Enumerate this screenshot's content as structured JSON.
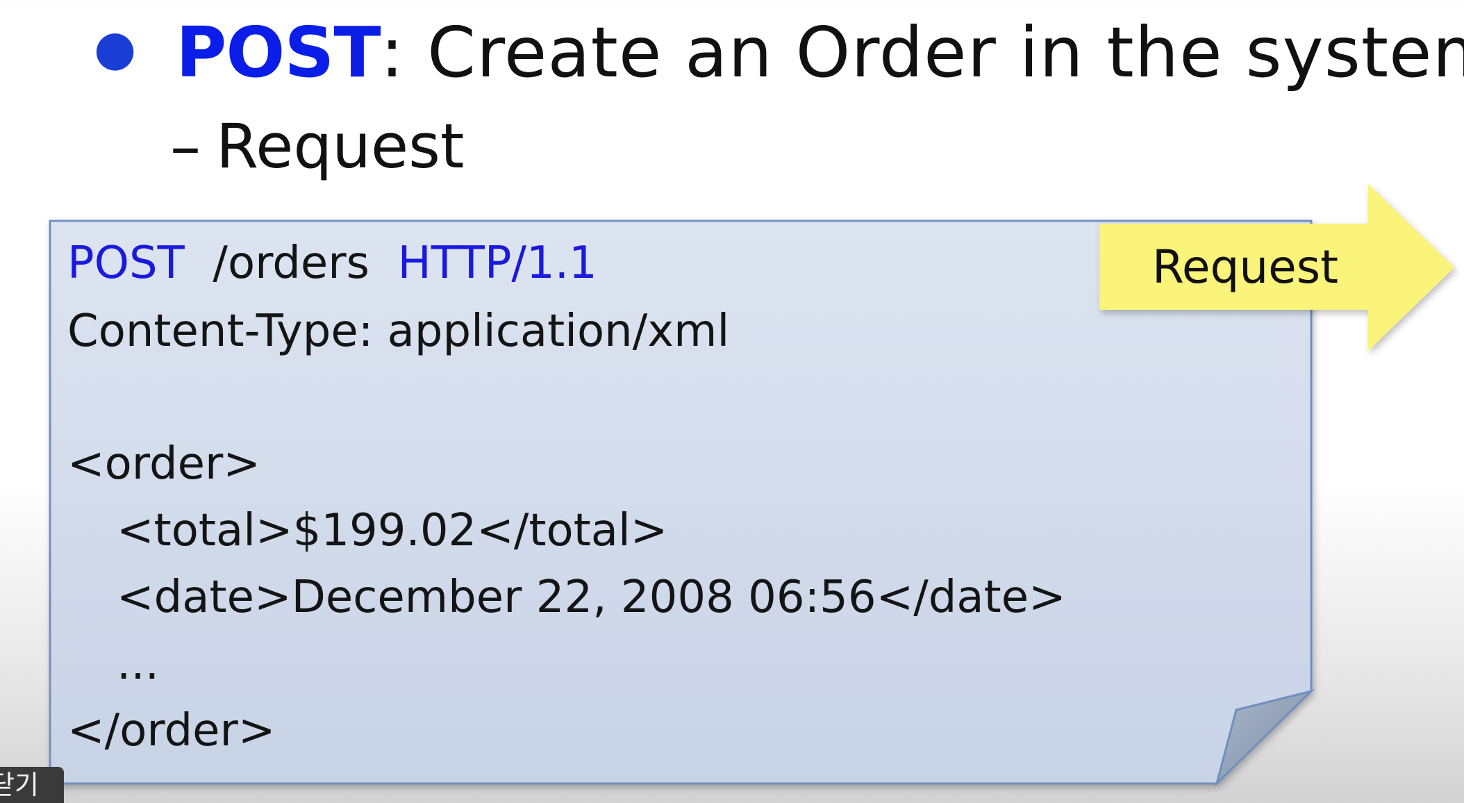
{
  "bullet": {
    "keyword": "POST",
    "text": ": Create an Order in the system"
  },
  "sub_bullet": {
    "dash": "–",
    "text": "Request"
  },
  "request_box": {
    "method": "POST",
    "path": "/orders",
    "protocol": "HTTP/1.1",
    "header": "Content-Type: application/xml",
    "lines": [
      "<order>",
      "<total>$199.02</total>",
      "<date>December 22, 2008 06:56</date>",
      "...",
      "</order>"
    ]
  },
  "arrow_label": "Request",
  "corner_tab_text": "닫기",
  "colors": {
    "keyword_blue": "#0a1ee8",
    "card_fill": "#dfe6f2",
    "card_border": "#6f8fc1",
    "arrow_fill": "#fbf47a"
  }
}
